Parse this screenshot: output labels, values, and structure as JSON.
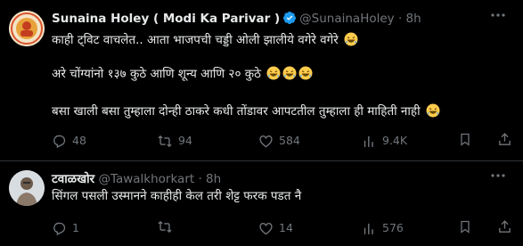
{
  "tweets": [
    {
      "author": {
        "name": "Sunaina Holey ( Modi Ka Parivar )",
        "handle": "@SunainaHoley",
        "time": "8h",
        "verified": true
      },
      "lines": [
        "काही ट्विट वाचलेत.. आता भाजपची चड्डी ओली झालीये वगेरे वगेरे",
        "अरे चोंग्यांनो १३७ कुठे आणि शून्य आणि २० कुठे",
        "बसा खाली बसा तुम्हाला दोन्ही ठाकरे कधी तोंडावर आपटतील तुम्हाला ही माहिती नाही"
      ],
      "stats": {
        "replies": "48",
        "reposts": "94",
        "likes": "584",
        "views": "9.4K"
      }
    },
    {
      "author": {
        "name": "टवाळखोर",
        "handle": "@Tawalkhorkart",
        "time": "8h",
        "verified": false
      },
      "lines": [
        "सिंगल पसली उस्मानने काहीही केल तरी शेट्ट फरक पडत नै"
      ],
      "stats": {
        "replies": "1",
        "reposts": "",
        "likes": "14",
        "views": "576"
      }
    }
  ],
  "icons": {
    "reply": "reply-icon",
    "repost": "repost-icon",
    "like": "like-icon",
    "views": "views-icon",
    "bookmark": "bookmark-icon",
    "share": "share-icon",
    "more": "more-icon",
    "verified": "verified-badge-icon",
    "emoji": "laughing-emoji"
  },
  "colors": {
    "background": "#000000",
    "text": "#e7e9ea",
    "muted": "#71767b",
    "verified": "#1d9bf0",
    "divider": "#2f3336"
  }
}
